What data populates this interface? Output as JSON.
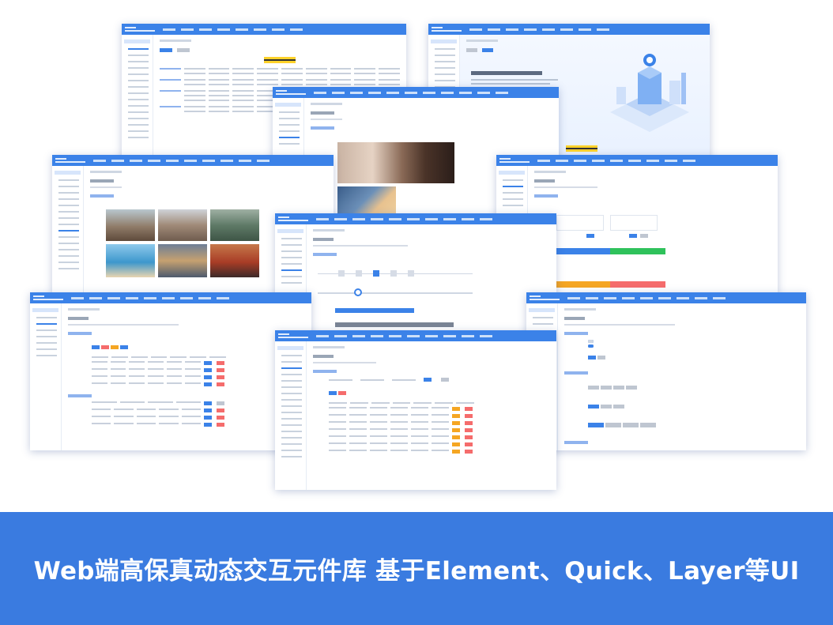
{
  "banner": {
    "text": "Web端高保真动态交互元件库 基于Element、Quick、Layer等UI"
  },
  "colors": {
    "banner_bg": "#3a7be0",
    "titlebar": "#3b82e8",
    "accent_yellow": "#ffd22b"
  }
}
